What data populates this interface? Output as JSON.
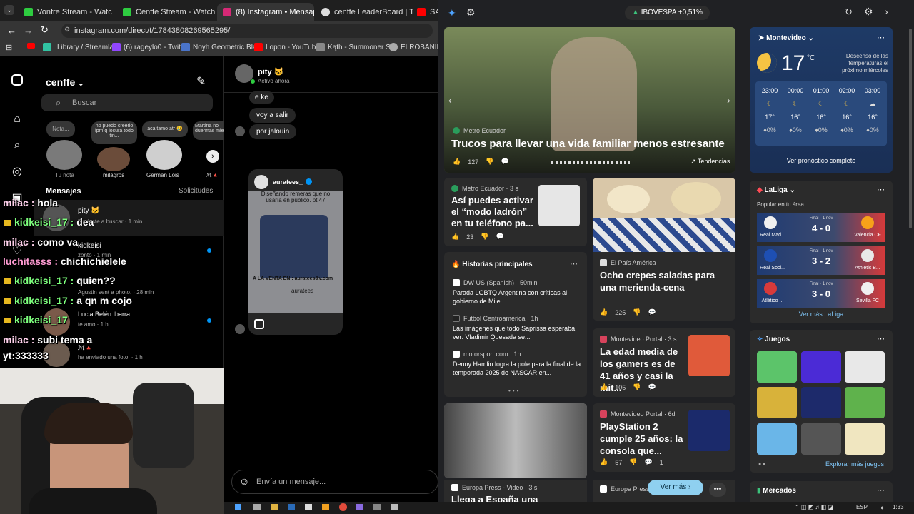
{
  "browser": {
    "tabs": [
      {
        "title": "Vonfre Stream - Watc",
        "color": "#2ecc40"
      },
      {
        "title": "Cenffe Stream - Watch Li",
        "color": "#2ecc40"
      },
      {
        "title": "(8) Instagram • Mensajes",
        "color": "#d62976"
      },
      {
        "title": "cenffe LeaderBoard | The",
        "color": "#dddddd"
      },
      {
        "title": "SA",
        "color": "#ff0000"
      }
    ],
    "url": "instagram.com/direct/t/17843808269565295/",
    "bookmarks": [
      "Library / Streamlabs",
      "(6) rageylo0 - Twitch",
      "Noyh Geometric Bla...",
      "Lopon - YouTube",
      "Kąth - Summoner St...",
      "ELROBANIÑOS"
    ]
  },
  "instagram": {
    "username": "cenffe",
    "search_placeholder": "Buscar",
    "notes": [
      {
        "note": "Nota...",
        "name": "Tu nota"
      },
      {
        "note": "no puedo creerlo lpm q locura todo tin...",
        "name": "milagros"
      },
      {
        "note": "aca tamo atr 😢",
        "name": "German Lois"
      },
      {
        "note": "Martina no duermas mie",
        "name": "ℳ🔺"
      }
    ],
    "messages_label": "Mensajes",
    "requests_label": "Solicitudes",
    "conversations": [
      {
        "name": "pity 🐱",
        "preview": "Enviaste a buscar · 1 min"
      },
      {
        "name": "kidkeisi",
        "preview": "zonto · 1 min"
      },
      {
        "name": "Agustin",
        "preview": "Agustin sent a photo. · 28 min"
      },
      {
        "name": "Lucia Belén Ibarra",
        "preview": "te amo · 1 h"
      },
      {
        "name": "ℳ🔺",
        "preview": "ha enviado una foto. · 1 h"
      }
    ],
    "chat": {
      "name": "pity 🐱",
      "status": "Activo ahora",
      "messages": [
        "e ke",
        "voy a salir",
        "por jalouin"
      ],
      "shared_post": {
        "account": "auratees_",
        "caption": "Diseñando remeras que no usaría en público. pt.47",
        "footer": "A LA VENTA EN : auratees&v.com",
        "handle": "auratees"
      },
      "composer_placeholder": "Envía un mensaje..."
    }
  },
  "stream_chat": [
    {
      "user": "milac",
      "text": "hola",
      "color": "#ffd1ec",
      "crown": false
    },
    {
      "user": "kidkeisi_17",
      "text": "dea",
      "color": "#7dff7d",
      "crown": true
    },
    {
      "user": "milac",
      "text": "como va",
      "color": "#ffd1ec",
      "crown": false
    },
    {
      "user": "luchitasss",
      "text": "chichichielele",
      "color": "#ff9bd3",
      "crown": false
    },
    {
      "user": "kidkeisi_17",
      "text": "quien??",
      "color": "#7dff7d",
      "crown": true
    },
    {
      "user": "kidkeisi_17",
      "text": "a qn m cojo",
      "color": "#7dff7d",
      "crown": true
    },
    {
      "user": "kidkeisi_17",
      "text": "",
      "color": "#7dff7d",
      "crown": true
    },
    {
      "user": "milac",
      "text": "subi tema a",
      "color": "#ffd1ec",
      "crown": false
    },
    {
      "user": "",
      "text": "yt:333333",
      "color": "#ffffff",
      "crown": false
    }
  ],
  "msn": {
    "ticker": "IBOVESPA +0,51%",
    "hero": {
      "source": "Metro Ecuador",
      "title": "Trucos para llevar una vida familiar menos estresante",
      "likes": "127",
      "trending": "Tendencias"
    },
    "card1": {
      "source": "Metro Ecuador · 3 s",
      "title": "Así puedes activar el “modo ladrón” en tu teléfono pa...",
      "likes": "23"
    },
    "card2": {
      "source": "El País América",
      "title": "Ocho crepes saladas para una merienda-cena",
      "likes": "225"
    },
    "top_stories": {
      "label": "Historias principales",
      "items": [
        {
          "source": "DW US (Spanish) · 50min",
          "title": "Parada LGBTQ Argentina con críticas al gobierno de Milei"
        },
        {
          "source": "Futbol Centroamérica · 1h",
          "title": "Las imágenes que todo Saprissa esperaba ver: Vladimir Quesada se..."
        },
        {
          "source": "motorsport.com · 1h",
          "title": "Denny Hamlin logra la pole para la final de la temporada 2025 de NASCAR en..."
        }
      ]
    },
    "card3": {
      "source": "Montevideo Portal · 3 s",
      "title": "La edad media de los gamers es de 41 años y casi la mit...",
      "likes": "105"
    },
    "card4": {
      "source": "Montevideo Portal · 6d",
      "title": "PlayStation 2 cumple 25 años: la consola que...",
      "likes": "57",
      "comments": "1"
    },
    "card5": {
      "source": "Europa Press - Video · 3 s",
      "title": "Llega a España una"
    },
    "card6": {
      "source": "Europa Press"
    },
    "see_more": "Ver más",
    "weather": {
      "location": "Montevideo",
      "temp": "17",
      "unit": "°C",
      "alert": "Descenso de las temperaturas el próximo miércoles",
      "hours": [
        {
          "time": "23:00",
          "temp": "17°",
          "rain": "0%"
        },
        {
          "time": "00:00",
          "temp": "16°",
          "rain": "0%"
        },
        {
          "time": "01:00",
          "temp": "16°",
          "rain": "0%"
        },
        {
          "time": "02:00",
          "temp": "16°",
          "rain": "0%"
        },
        {
          "time": "03:00",
          "temp": "16°",
          "rain": "0%"
        }
      ],
      "forecast_button": "Ver pronóstico completo"
    },
    "laliga": {
      "title": "LaLiga",
      "subtitle": "Popular en tu área",
      "matches": [
        {
          "home": "Real Mad...",
          "away": "Valencia CF",
          "status": "Final · 1 nov",
          "score": "4 - 0"
        },
        {
          "home": "Real Soci...",
          "away": "Athletic B...",
          "status": "Final · 1 nov",
          "score": "3 - 2"
        },
        {
          "home": "Atlético ...",
          "away": "Sevilla FC",
          "status": "Final · 1 nov",
          "score": "3 - 0"
        }
      ],
      "more": "Ver más LaLiga"
    },
    "games": {
      "title": "Juegos",
      "more": "Explorar más juegos"
    },
    "markets": "Mercados"
  },
  "taskbar": {
    "lang": "ESP",
    "time": "1:33"
  }
}
